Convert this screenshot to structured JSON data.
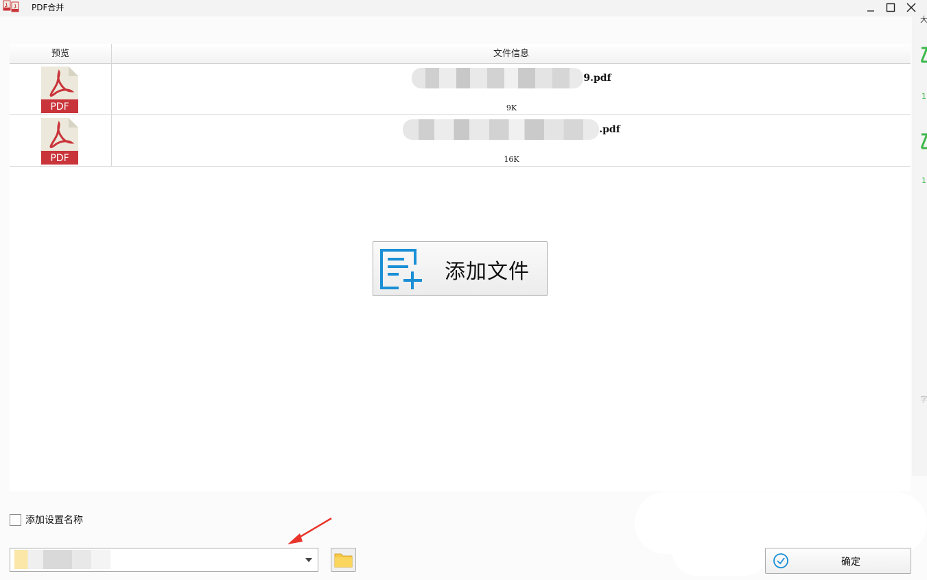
{
  "window": {
    "title": "PDF合并",
    "icon": "pdf-merge-app-icon"
  },
  "window_controls": {
    "minimize": "—",
    "maximize": "☐",
    "close": "✕"
  },
  "right_strip": {
    "texts": [
      "大",
      "1",
      "1",
      "字"
    ],
    "accent": "#3cb84a"
  },
  "table": {
    "columns": [
      "预览",
      "文件信息"
    ],
    "rows": [
      {
        "preview_label": "PDF",
        "name_tail": "9.pdf",
        "size": "9K"
      },
      {
        "preview_label": "PDF",
        "name_tail": ".pdf",
        "size": "16K"
      }
    ]
  },
  "add_file_button": {
    "label": "添加文件",
    "icon": "add-file-icon",
    "icon_color": "#1a8fd6"
  },
  "options": {
    "add_settings_name_label": "添加设置名称",
    "add_settings_name_checked": false
  },
  "output": {
    "folder_icon": "folder-icon"
  },
  "confirm_button": {
    "label": "确定",
    "icon": "check-circle-icon"
  },
  "colors": {
    "pdf_red": "#c9343a",
    "pdf_paper": "#ece9dc",
    "folder_yellow": "#f7c948"
  }
}
